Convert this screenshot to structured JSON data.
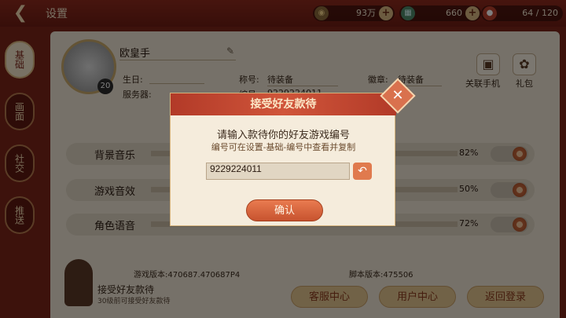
{
  "header": {
    "title": "设置",
    "back_icon": "back-arrow-icon"
  },
  "resources": [
    {
      "name": "coin",
      "value": "93万",
      "icon": "coin-icon"
    },
    {
      "name": "ticket",
      "value": "660",
      "icon": "ticket-icon"
    },
    {
      "name": "stamina",
      "value": "64 / 120",
      "icon": "stamina-icon"
    }
  ],
  "tabs": [
    {
      "label": "基础",
      "active": true
    },
    {
      "label": "画面",
      "active": false
    },
    {
      "label": "社交",
      "active": false
    },
    {
      "label": "推送",
      "active": false
    }
  ],
  "profile": {
    "name": "欧皇手",
    "level": "20",
    "birthday_label": "生日:",
    "title_label": "称号:",
    "title_value": "待装备",
    "badge_label": "徽章:",
    "badge_value": "待装备",
    "server_label": "服务器:",
    "id_label": "编号:",
    "id_value": "9229224011"
  },
  "links": [
    {
      "label": "关联手机"
    },
    {
      "label": "礼包"
    }
  ],
  "settings": [
    {
      "label": "背景音乐",
      "percent_text": "82%",
      "value": 82
    },
    {
      "label": "游戏音效",
      "percent_text": "50%",
      "value": 50
    },
    {
      "label": "角色语音",
      "percent_text": "72%",
      "value": 72
    }
  ],
  "versions": {
    "game": "游戏版本:470687.470687P4",
    "script": "脚本版本:475506"
  },
  "promo": {
    "title": "接受好友款待",
    "subtitle": "30级前可接受好友款待"
  },
  "bottom_buttons": [
    "客服中心",
    "用户中心",
    "返回登录"
  ],
  "modal": {
    "title": "接受好友款待",
    "line1": "请输入款待你的好友游戏编号",
    "line2": "编号可在设置-基础-编号中查看并复制",
    "input_value": "9229224011",
    "confirm": "确认"
  },
  "colors": {
    "accent": "#c7532f",
    "panel": "#ece3d3",
    "header": "#7a2418"
  }
}
